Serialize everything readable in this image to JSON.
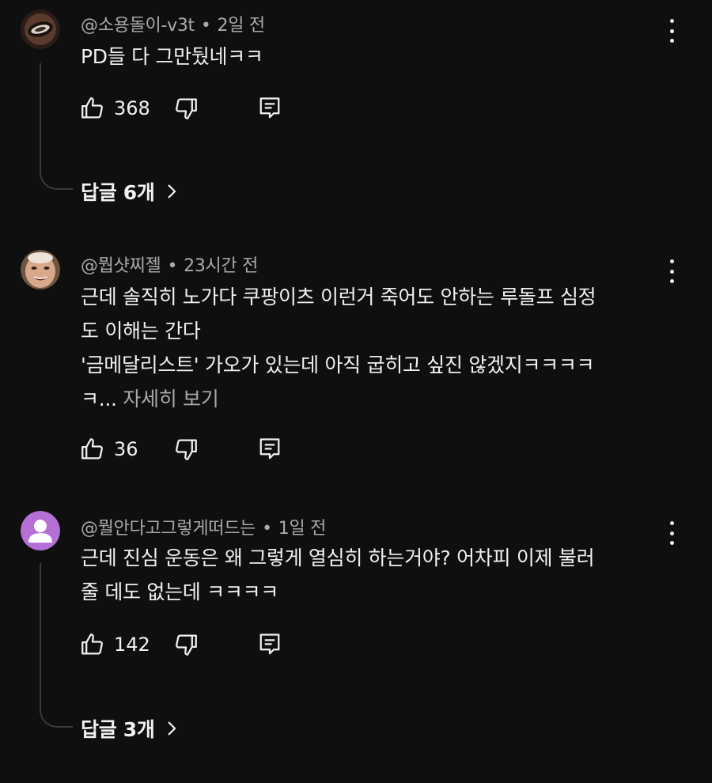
{
  "comments": [
    {
      "author": "@소용돌이-v3t",
      "time": "2일 전",
      "lines": [
        "PD들 다 그만뒀네ㅋㅋ"
      ],
      "more_label": "",
      "likes": "368",
      "replies_label": "답글 6개",
      "avatar_icon": "swirl-avatar-icon"
    },
    {
      "author": "@뭡샷찌젤",
      "time": "23시간 전",
      "lines": [
        "근데 솔직히 노가다 쿠팡이츠 이런거 죽어도 안하는 루돌프 심정",
        "도 이해는 간다",
        "'금메달리스트' 가오가 있는데 아직 굽히고 싶진 않겠지ㅋㅋㅋㅋ",
        "ㅋ..."
      ],
      "more_label": "자세히 보기",
      "likes": "36",
      "replies_label": "",
      "avatar_icon": "face-avatar-icon"
    },
    {
      "author": "@뭘안다고그렇게떠드는",
      "time": "1일 전",
      "lines": [
        "근데 진심 운동은 왜 그렇게 열심히 하는거야? 어차피 이제 불러",
        "줄 데도 없는데 ㅋㅋㅋㅋ"
      ],
      "more_label": "",
      "likes": "142",
      "replies_label": "답글 3개",
      "avatar_icon": "default-person-avatar-icon"
    }
  ],
  "colors": {
    "background": "#0f0f0f",
    "text": "#f1f1f1",
    "secondary_text": "#aaaaaa",
    "default_avatar": "#b56fd6"
  },
  "icons": [
    "like-icon",
    "dislike-icon",
    "reply-icon",
    "more-options-icon",
    "chevron-right-icon"
  ]
}
